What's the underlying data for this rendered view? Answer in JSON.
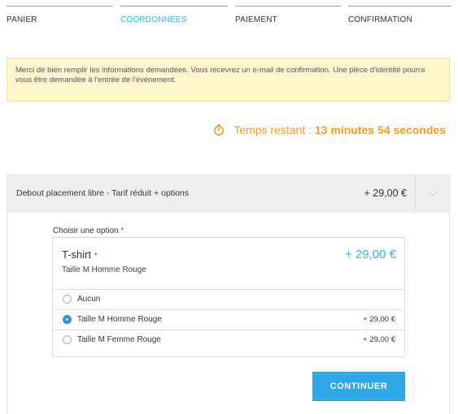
{
  "steps": [
    {
      "label": "PANIER",
      "active": false
    },
    {
      "label": "COORDONNÉES",
      "active": true
    },
    {
      "label": "PAIEMENT",
      "active": false
    },
    {
      "label": "CONFIRMATION",
      "active": false
    }
  ],
  "notice": {
    "text": "Merci de bien remplir les informations demandées. Vous recevrez un e-mail de confirmation. Une pièce d'identité pourra vous être demandée à l'entrée de l'événement."
  },
  "timer": {
    "prefix": "Temps restant : ",
    "value": "13 minutes 54 secondes",
    "icon": "stopwatch-icon",
    "color": "#f59a24"
  },
  "ticket": {
    "name": "Debout placement libre - Tarif réduit + options",
    "price": "+ 29,00 €",
    "toggle_icon": "chevron-down-icon"
  },
  "option": {
    "label": "Choisir une option",
    "required_mark": "*",
    "product_title": "T-shirt",
    "product_subtitle": "Taille M Homme Rouge",
    "product_price": "+ 29,00 €",
    "choices": [
      {
        "label": "Aucun",
        "price": "",
        "selected": false
      },
      {
        "label": "Taille M Homme Rouge",
        "price": "+ 29,00 €",
        "selected": true
      },
      {
        "label": "Taille M Femme Rouge",
        "price": "+ 29,00 €",
        "selected": false
      }
    ]
  },
  "actions": {
    "continue_label": "CONTINUER"
  },
  "colors": {
    "accent": "#35b5e0",
    "button": "#2ea8e6",
    "warning": "#f59a24",
    "required": "#e02b2b",
    "notice_bg": "#fff6cc"
  }
}
